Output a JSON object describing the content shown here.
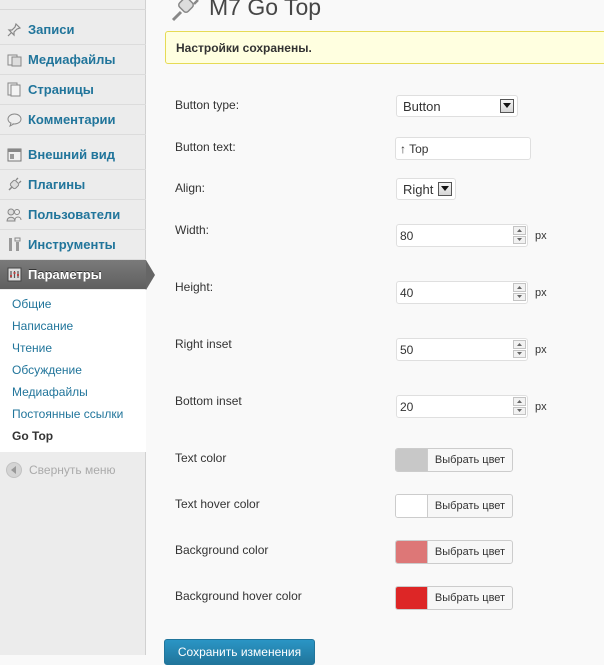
{
  "sidebar": {
    "items": [
      {
        "id": "posts",
        "label": "Записи",
        "icon": "pin-icon"
      },
      {
        "id": "media",
        "label": "Медиафайлы",
        "icon": "media-icon"
      },
      {
        "id": "pages",
        "label": "Страницы",
        "icon": "pages-icon"
      },
      {
        "id": "comments",
        "label": "Комментарии",
        "icon": "comment-icon"
      },
      {
        "id": "appearance",
        "label": "Внешний вид",
        "icon": "appearance-icon"
      },
      {
        "id": "plugins",
        "label": "Плагины",
        "icon": "plug-icon"
      },
      {
        "id": "users",
        "label": "Пользователи",
        "icon": "users-icon"
      },
      {
        "id": "tools",
        "label": "Инструменты",
        "icon": "tools-icon"
      },
      {
        "id": "settings",
        "label": "Параметры",
        "icon": "settings-icon",
        "active": true
      }
    ],
    "submenu": [
      "Общие",
      "Написание",
      "Чтение",
      "Обсуждение",
      "Медиафайлы",
      "Постоянные ссылки",
      "Go Top"
    ],
    "submenu_current": "Go Top",
    "collapse_label": "Свернуть меню"
  },
  "page": {
    "title": "M7 Go Top",
    "notice": "Настройки сохранены."
  },
  "form": {
    "button_type": {
      "label": "Button type:",
      "value": "Button"
    },
    "button_text": {
      "label": "Button text:",
      "value": "↑ Top"
    },
    "align": {
      "label": "Align:",
      "value": "Right"
    },
    "width": {
      "label": "Width:",
      "value": "80",
      "unit": "px"
    },
    "height": {
      "label": "Height:",
      "value": "40",
      "unit": "px"
    },
    "right_inset": {
      "label": "Right inset",
      "value": "50",
      "unit": "px"
    },
    "bottom_inset": {
      "label": "Bottom inset",
      "value": "20",
      "unit": "px"
    },
    "text_color": {
      "label": "Text color",
      "color": "#c8c8c8",
      "button": "Выбрать цвет"
    },
    "text_hover_color": {
      "label": "Text hover color",
      "color": "#ffffff",
      "button": "Выбрать цвет"
    },
    "background_color": {
      "label": "Background color",
      "color": "#dd7777",
      "button": "Выбрать цвет"
    },
    "background_hover_color": {
      "label": "Background hover color",
      "color": "#dd2626",
      "button": "Выбрать цвет"
    },
    "save_label": "Сохранить изменения"
  },
  "colors": {
    "link": "#21759b",
    "notice_bg": "#ffffe0",
    "notice_border": "#e6db55",
    "primary": "#21759b"
  }
}
